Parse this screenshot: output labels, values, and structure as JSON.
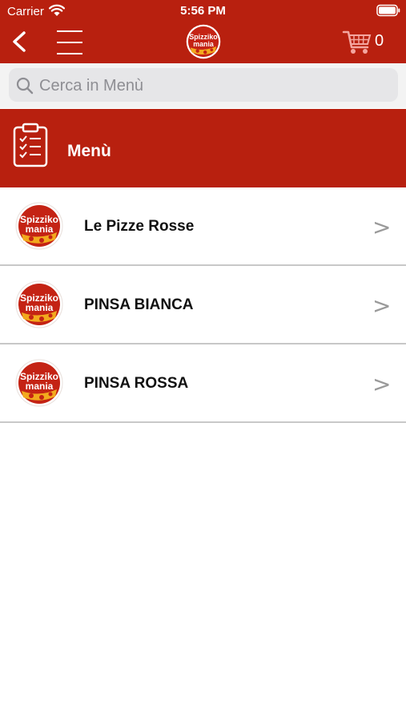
{
  "status_bar": {
    "carrier": "Carrier",
    "time": "5:56 PM"
  },
  "header": {
    "logo_text_line1": "Spizziko",
    "logo_text_line2": "mania",
    "cart_count": "0"
  },
  "search": {
    "placeholder": "Cerca in Menù",
    "value": ""
  },
  "section": {
    "title": "Menù"
  },
  "menu_items": [
    {
      "label": "Le Pizze Rosse",
      "chevron": ">"
    },
    {
      "label": "PINSA BIANCA",
      "chevron": ">"
    },
    {
      "label": "PINSA ROSSA",
      "chevron": ">"
    }
  ],
  "colors": {
    "brand_red": "#b8200f",
    "logo_yellow": "#f2a91d"
  },
  "icons": [
    "wifi-icon",
    "battery-icon",
    "back-icon",
    "hamburger-icon",
    "cart-icon",
    "search-icon",
    "clipboard-icon",
    "chevron-right-icon"
  ]
}
